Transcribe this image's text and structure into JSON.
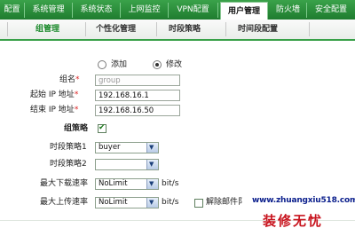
{
  "nav": {
    "tabs": [
      {
        "label": "配置",
        "active": false
      },
      {
        "label": "系统管理",
        "active": false
      },
      {
        "label": "系统状态",
        "active": false
      },
      {
        "label": "上网监控",
        "active": false
      },
      {
        "label": "VPN配置",
        "active": false
      },
      {
        "label": "用户管理",
        "active": true
      },
      {
        "label": "防火墙",
        "active": false
      },
      {
        "label": "安全配置",
        "active": false
      }
    ]
  },
  "subnav": {
    "tabs": [
      {
        "label": "组管理",
        "active": true
      },
      {
        "label": "个性化管理",
        "active": false
      },
      {
        "label": "时段策略",
        "active": false
      },
      {
        "label": "时间段配置",
        "active": false
      }
    ]
  },
  "form": {
    "mode": {
      "add_label": "添加",
      "edit_label": "修改",
      "selected": "edit"
    },
    "group_name": {
      "label": "组名",
      "required_mark": "*",
      "value": "group"
    },
    "start_ip": {
      "label": "起始 IP 地址",
      "required_mark": "*",
      "value": "192.168.16.1"
    },
    "end_ip": {
      "label": "结束 IP 地址",
      "required_mark": "*",
      "value": "192.168.16.50"
    },
    "group_policy": {
      "label": "组策略",
      "checked": true
    },
    "time_policy_1": {
      "label": "时段策略1",
      "value": "buyer"
    },
    "time_policy_2": {
      "label": "时段策略2",
      "value": ""
    },
    "max_download": {
      "label": "最大下载速率",
      "value": "NoLimit",
      "unit": "bit/s"
    },
    "max_upload": {
      "label": "最大上传速率",
      "value": "NoLimit",
      "unit": "bit/s"
    },
    "unblock_mail": {
      "label": "解除邮件阝"
    }
  },
  "watermark": {
    "url": "www.zhuangxiu518.com",
    "text": "装修无忧",
    "url_color": "#0a1e8c",
    "text_color": "#c8141e"
  },
  "colors": {
    "accent": "#2a9138",
    "required": "#dd2222"
  }
}
